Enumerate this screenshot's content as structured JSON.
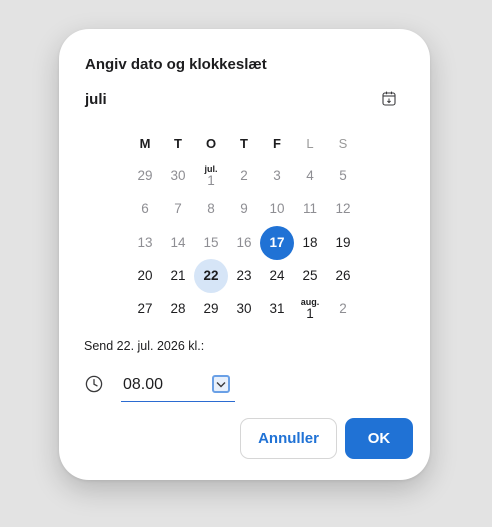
{
  "dialog": {
    "title": "Angiv dato og klokkeslæt",
    "month": "juli",
    "weekdays": [
      "M",
      "T",
      "O",
      "T",
      "F",
      "L",
      "S"
    ],
    "weeks": [
      [
        {
          "label": "29"
        },
        {
          "label": "30"
        },
        {
          "label": "1",
          "month": "jul."
        },
        {
          "label": "2"
        },
        {
          "label": "3"
        },
        {
          "label": "4"
        },
        {
          "label": "5"
        }
      ],
      [
        {
          "label": "6"
        },
        {
          "label": "7"
        },
        {
          "label": "8"
        },
        {
          "label": "9"
        },
        {
          "label": "10"
        },
        {
          "label": "11"
        },
        {
          "label": "12"
        }
      ],
      [
        {
          "label": "13"
        },
        {
          "label": "14"
        },
        {
          "label": "15"
        },
        {
          "label": "16"
        },
        {
          "label": "17",
          "state": "selected"
        },
        {
          "label": "18"
        },
        {
          "label": "19"
        }
      ],
      [
        {
          "label": "20"
        },
        {
          "label": "21"
        },
        {
          "label": "22",
          "state": "pending"
        },
        {
          "label": "23"
        },
        {
          "label": "24"
        },
        {
          "label": "25"
        },
        {
          "label": "26"
        }
      ],
      [
        {
          "label": "27"
        },
        {
          "label": "28"
        },
        {
          "label": "29"
        },
        {
          "label": "30"
        },
        {
          "label": "31"
        },
        {
          "label": "1",
          "month": "aug."
        },
        {
          "label": "2"
        }
      ]
    ],
    "send_text": "Send 22. jul. 2026 kl.:",
    "time_value": "08.00",
    "cancel_label": "Annuller",
    "ok_label": "OK"
  },
  "icons": {
    "calendar": "calendar-icon",
    "clock": "clock-icon",
    "dropdown": "chevron-down-icon"
  },
  "colors": {
    "accent": "#2072d5",
    "selected_text": "#ffffff",
    "pending_bg": "#d6e5f7",
    "past_text": "#8e8e93",
    "weekend_header": "#9a9a9a"
  }
}
